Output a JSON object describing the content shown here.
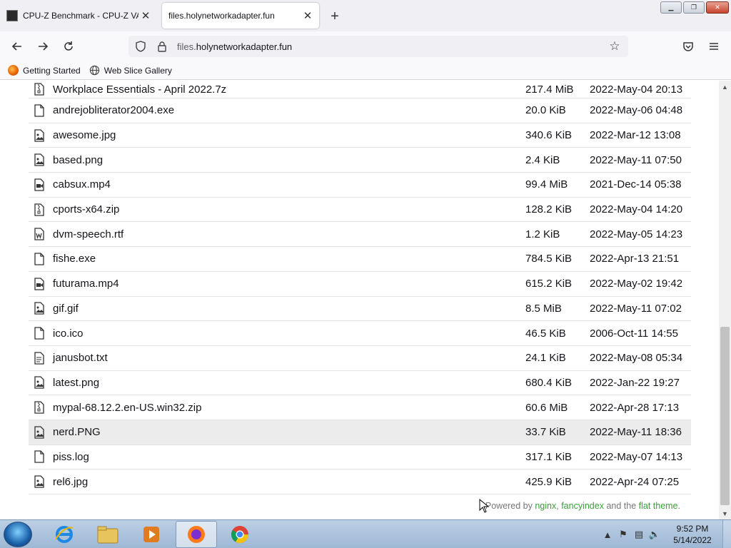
{
  "browser": {
    "tabs": [
      {
        "title": "CPU-Z Benchmark - CPU-Z VAL",
        "active": false
      },
      {
        "title": "files.holynetworkadapter.fun",
        "active": true
      }
    ],
    "url": {
      "prefix": "files.",
      "host": "holynetworkadapter.fun"
    },
    "bookmarks": [
      {
        "label": "Getting Started",
        "icon": "firefox-icon"
      },
      {
        "label": "Web Slice Gallery",
        "icon": "globe-icon"
      }
    ]
  },
  "files": [
    {
      "name": "Workplace Essentials - April 2022.7z",
      "size": "217.4 MiB",
      "date": "2022-May-04 20:13",
      "icon": "archive-icon"
    },
    {
      "name": "andrejobliterator2004.exe",
      "size": "20.0 KiB",
      "date": "2022-May-06 04:48",
      "icon": "file-icon"
    },
    {
      "name": "awesome.jpg",
      "size": "340.6 KiB",
      "date": "2022-Mar-12 13:08",
      "icon": "image-icon"
    },
    {
      "name": "based.png",
      "size": "2.4 KiB",
      "date": "2022-May-11 07:50",
      "icon": "image-icon"
    },
    {
      "name": "cabsux.mp4",
      "size": "99.4 MiB",
      "date": "2021-Dec-14 05:38",
      "icon": "video-icon"
    },
    {
      "name": "cports-x64.zip",
      "size": "128.2 KiB",
      "date": "2022-May-04 14:20",
      "icon": "archive-icon"
    },
    {
      "name": "dvm-speech.rtf",
      "size": "1.2 KiB",
      "date": "2022-May-05 14:23",
      "icon": "word-icon"
    },
    {
      "name": "fishe.exe",
      "size": "784.5 KiB",
      "date": "2022-Apr-13 21:51",
      "icon": "file-icon"
    },
    {
      "name": "futurama.mp4",
      "size": "615.2 KiB",
      "date": "2022-May-02 19:42",
      "icon": "video-icon"
    },
    {
      "name": "gif.gif",
      "size": "8.5 MiB",
      "date": "2022-May-11 07:02",
      "icon": "image-icon"
    },
    {
      "name": "ico.ico",
      "size": "46.5 KiB",
      "date": "2006-Oct-11 14:55",
      "icon": "file-icon"
    },
    {
      "name": "janusbot.txt",
      "size": "24.1 KiB",
      "date": "2022-May-08 05:34",
      "icon": "text-icon"
    },
    {
      "name": "latest.png",
      "size": "680.4 KiB",
      "date": "2022-Jan-22 19:27",
      "icon": "image-icon"
    },
    {
      "name": "mypal-68.12.2.en-US.win32.zip",
      "size": "60.6 MiB",
      "date": "2022-Apr-28 17:13",
      "icon": "archive-icon"
    },
    {
      "name": "nerd.PNG",
      "size": "33.7 KiB",
      "date": "2022-May-11 18:36",
      "icon": "image-icon"
    },
    {
      "name": "piss.log",
      "size": "317.1 KiB",
      "date": "2022-May-07 14:13",
      "icon": "file-icon"
    },
    {
      "name": "rel6.jpg",
      "size": "425.9 KiB",
      "date": "2022-Apr-24 07:25",
      "icon": "image-icon"
    }
  ],
  "footer": {
    "prefix": "Powered by ",
    "link1": "nginx",
    "sep": ", ",
    "link2": "fancyindex",
    "mid": " and the ",
    "link3": "flat theme",
    "suffix": "."
  },
  "taskbar": {
    "apps": [
      {
        "name": "internet-explorer",
        "active": false
      },
      {
        "name": "file-explorer",
        "active": false
      },
      {
        "name": "media-player",
        "active": false
      },
      {
        "name": "firefox",
        "active": true
      },
      {
        "name": "chrome",
        "active": false
      }
    ],
    "clock": {
      "time": "9:52 PM",
      "date": "5/14/2022"
    }
  }
}
